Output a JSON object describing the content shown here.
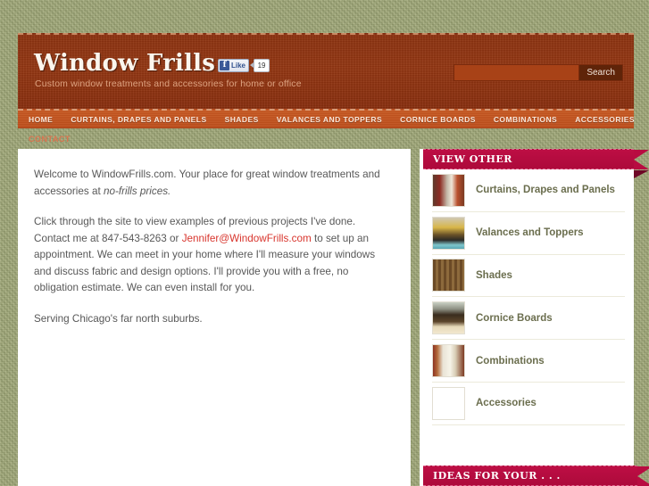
{
  "site": {
    "title": "Window Frills",
    "tagline": "Custom window treatments and accessories for home or office"
  },
  "social": {
    "like_label": "Like",
    "like_count": "19",
    "icon": "facebook-icon"
  },
  "search": {
    "value": "",
    "placeholder": "",
    "button_label": "Search"
  },
  "nav": {
    "items": [
      {
        "label": "HOME"
      },
      {
        "label": "CURTAINS, DRAPES AND PANELS"
      },
      {
        "label": "SHADES"
      },
      {
        "label": "VALANCES AND TOPPERS"
      },
      {
        "label": "CORNICE BOARDS"
      },
      {
        "label": "COMBINATIONS"
      },
      {
        "label": "ACCESSORIES"
      }
    ]
  },
  "subnav": {
    "items": [
      {
        "label": "CONTACT"
      }
    ]
  },
  "content": {
    "para1_before": "Welcome to WindowFrills.com. Your place for great window treatments and accessories at ",
    "para1_italic": "no-frills prices.",
    "para2_before": "Click through the site to view examples of previous projects I've done. Contact me at 847-543-8263 or ",
    "para2_link": "Jennifer@WindowFrills.com",
    "para2_after": " to set up an appointment. We can meet in your home where I'll measure your windows and discuss fabric and design options. I'll provide you with a free, no obligation estimate. We can even install for you.",
    "para3": "Serving Chicago's far north suburbs."
  },
  "sidebar": {
    "view_other_heading": "VIEW OTHER",
    "ideas_heading": "IDEAS FOR YOUR . . .",
    "items": [
      {
        "label": "Curtains, Drapes and Panels",
        "thumb": "curtains-thumbnail"
      },
      {
        "label": "Valances and Toppers",
        "thumb": "valances-thumbnail"
      },
      {
        "label": "Shades",
        "thumb": "shades-thumbnail"
      },
      {
        "label": "Cornice Boards",
        "thumb": "cornice-thumbnail"
      },
      {
        "label": "Combinations",
        "thumb": "combinations-thumbnail"
      },
      {
        "label": "Accessories",
        "thumb": "accessories-thumbnail"
      }
    ]
  },
  "colors": {
    "page_background": "#a4ab7b",
    "header": "#8d3210",
    "nav": "#c4541f",
    "accent_crimson": "#b80c41",
    "link_red": "#d8352d",
    "sidebar_label": "#6b6e4e"
  }
}
